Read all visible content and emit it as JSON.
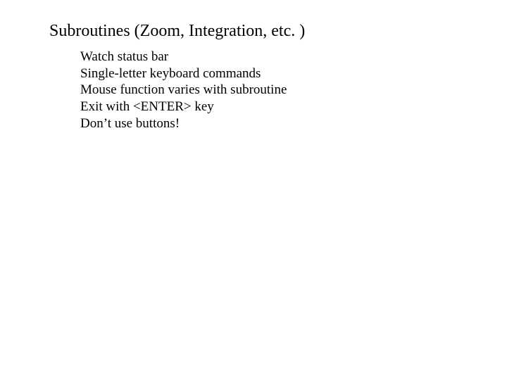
{
  "slide": {
    "title": "Subroutines (Zoom, Integration, etc. )",
    "body": {
      "lines": [
        "Watch status bar",
        "Single-letter keyboard commands",
        "Mouse function varies with subroutine",
        "Exit with <ENTER> key",
        "Don’t use buttons!"
      ]
    }
  }
}
